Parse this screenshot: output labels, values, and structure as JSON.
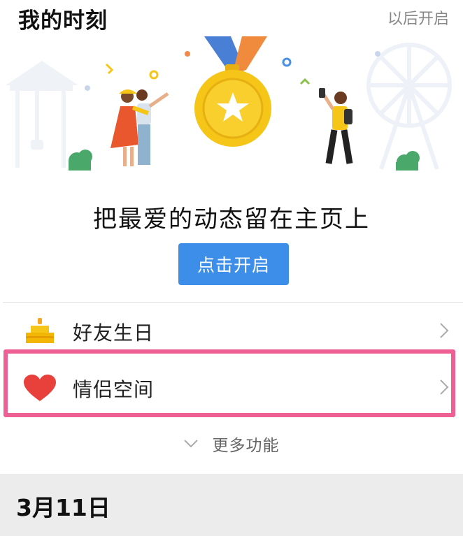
{
  "header": {
    "title": "我的时刻",
    "later_label": "以后开启"
  },
  "promo": {
    "headline": "把最爱的动态留在主页上",
    "button_label": "点击开启"
  },
  "features": [
    {
      "label": "好友生日",
      "icon": "cake-icon"
    },
    {
      "label": "情侣空间",
      "icon": "heart-icon",
      "highlighted": true
    }
  ],
  "more": {
    "label": "更多功能",
    "icon": "chevron-down-icon"
  },
  "date_section": {
    "date": "3月11日"
  },
  "colors": {
    "accent": "#3d8ee8",
    "highlight": "#ee5f93",
    "heart": "#e8413c",
    "medal": "#f5c518"
  }
}
